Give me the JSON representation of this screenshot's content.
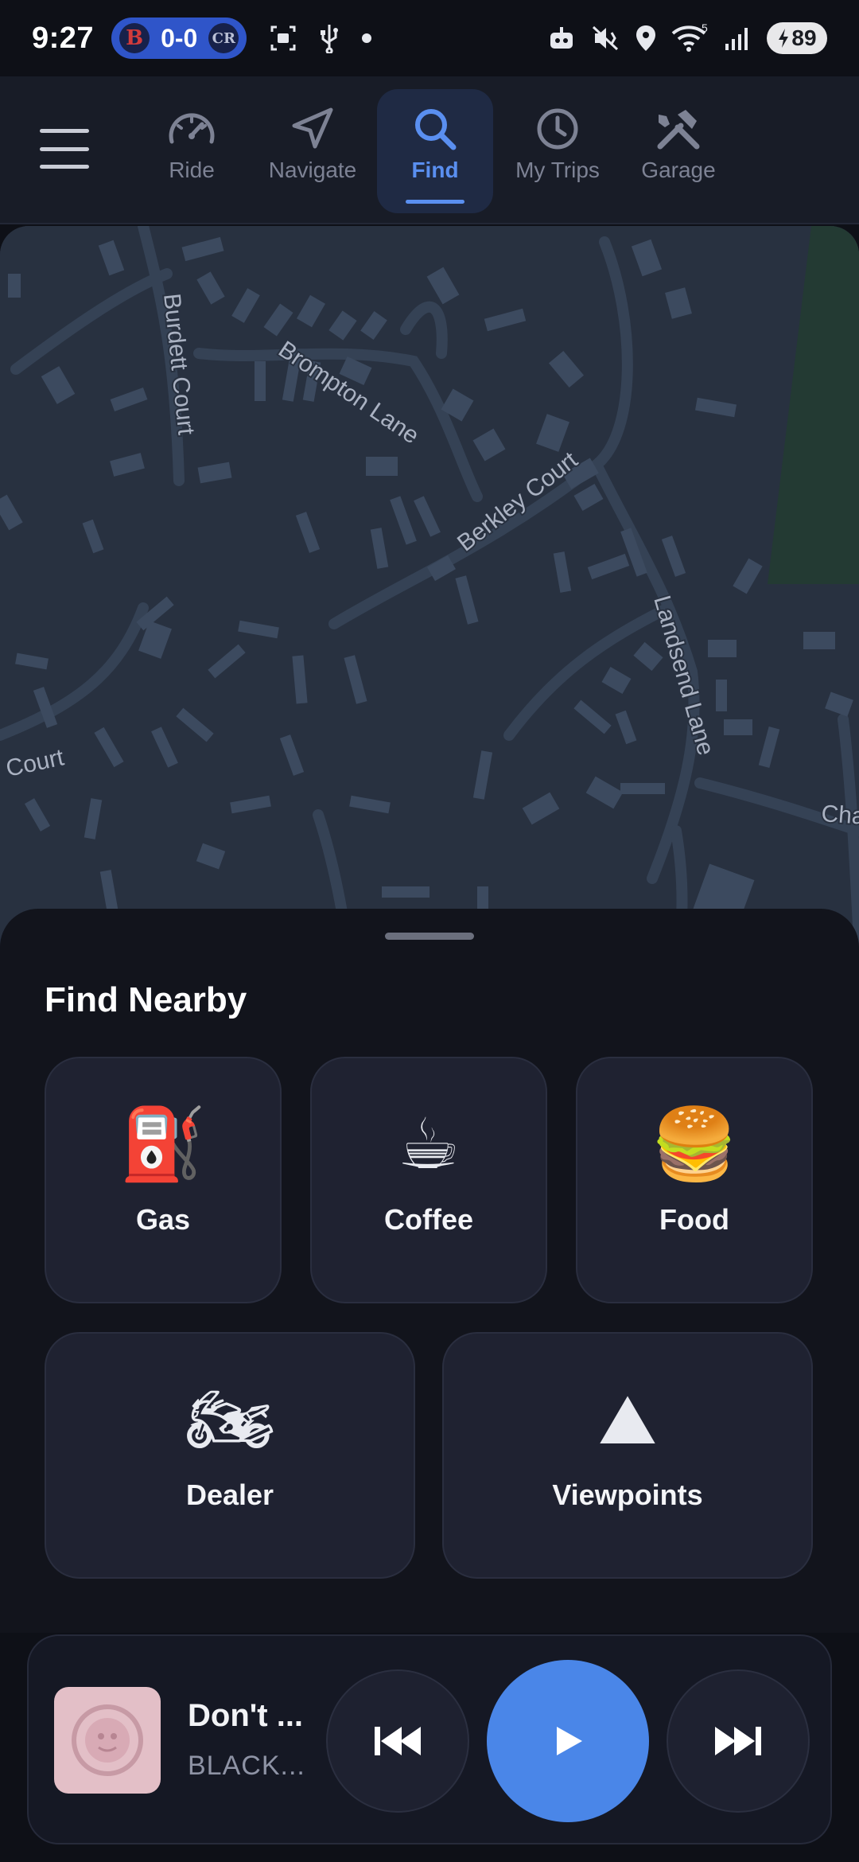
{
  "status_bar": {
    "time": "9:27",
    "score": "0-0",
    "battery": "89",
    "network": "5"
  },
  "nav": {
    "tabs": [
      {
        "label": "Ride",
        "icon": "speedometer-icon"
      },
      {
        "label": "Navigate",
        "icon": "navigate-arrow-icon"
      },
      {
        "label": "Find",
        "icon": "search-icon",
        "active": true
      },
      {
        "label": "My Trips",
        "icon": "clock-icon"
      },
      {
        "label": "Garage",
        "icon": "tools-icon"
      }
    ]
  },
  "map": {
    "streets": [
      "Burdett Court",
      "Brompton Lane",
      "Berkley Court",
      "Landsend Lane",
      "Court",
      "Cha"
    ]
  },
  "find_nearby": {
    "title": "Find Nearby",
    "categories": [
      {
        "label": "Gas",
        "emoji": "⛽"
      },
      {
        "label": "Coffee",
        "emoji": "☕"
      },
      {
        "label": "Food",
        "emoji": "🍔"
      },
      {
        "label": "Dealer",
        "emoji": "🏍"
      },
      {
        "label": "Viewpoints",
        "emoji": "⛰"
      }
    ]
  },
  "player": {
    "title": "Don't ...",
    "artist": "BLACK..."
  },
  "colors": {
    "accent": "#4a86e8",
    "background": "#0e1017",
    "card": "#1f2231",
    "map": "#283140"
  }
}
